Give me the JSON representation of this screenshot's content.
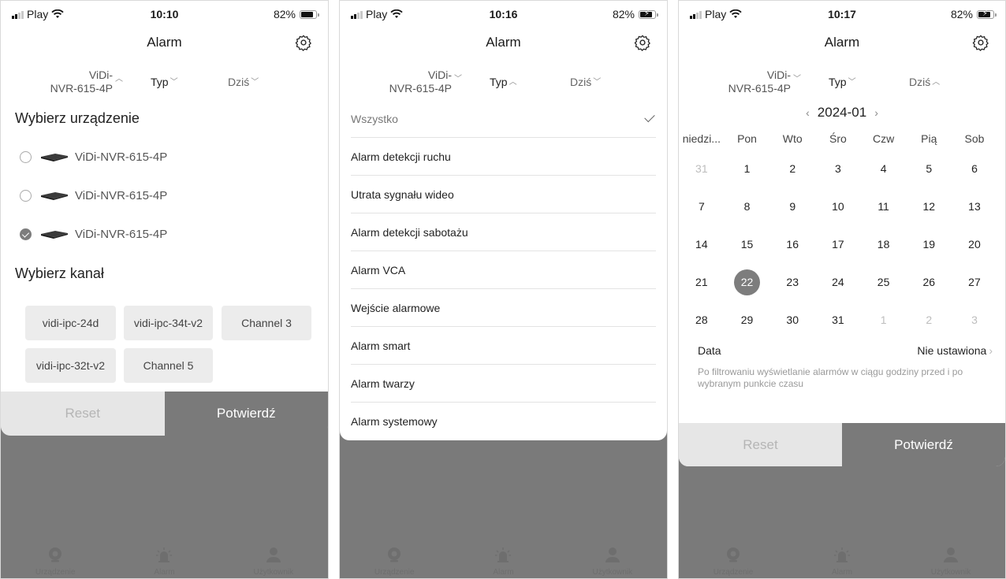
{
  "colors": {
    "accent": "#7a7a7a",
    "overlay": "#7a7a7a",
    "muted_text": "#bdbdbd"
  },
  "screens": [
    {
      "status": {
        "carrier": "Play",
        "time": "10:10",
        "battery": "82%",
        "charging": false
      },
      "title": "Alarm",
      "filters": {
        "device_line1": "ViDi-",
        "device_line2": "NVR-615-4P",
        "type": "Typ",
        "date": "Dziś"
      },
      "select_device_title": "Wybierz urządzenie",
      "devices": [
        {
          "name": "ViDi-NVR-615-4P",
          "selected": false
        },
        {
          "name": "ViDi-NVR-615-4P",
          "selected": false
        },
        {
          "name": "ViDi-NVR-615-4P",
          "selected": true
        }
      ],
      "select_channel_title": "Wybierz kanał",
      "channels": [
        "vidi-ipc-24d",
        "vidi-ipc-34t-v2",
        "Channel 3",
        "vidi-ipc-32t-v2",
        "Channel 5"
      ],
      "reset_label": "Reset",
      "confirm_label": "Potwierdź"
    },
    {
      "status": {
        "carrier": "Play",
        "time": "10:16",
        "battery": "82%",
        "charging": true
      },
      "title": "Alarm",
      "filters": {
        "device_line1": "ViDi-",
        "device_line2": "NVR-615-4P",
        "type": "Typ",
        "date": "Dziś"
      },
      "types": [
        "Wszystko",
        "Alarm detekcji ruchu",
        "Utrata sygnału wideo",
        "Alarm detekcji sabotażu",
        "Alarm VCA",
        "Wejście alarmowe",
        "Alarm smart",
        "Alarm twarzy",
        "Alarm systemowy"
      ],
      "selected_type": "Wszystko"
    },
    {
      "status": {
        "carrier": "Play",
        "time": "10:17",
        "battery": "82%",
        "charging": true
      },
      "title": "Alarm",
      "filters": {
        "device_line1": "ViDi-",
        "device_line2": "NVR-615-4P",
        "type": "Typ",
        "date": "Dziś"
      },
      "month": "2024-01",
      "weekdays": [
        "niedzi...",
        "Pon",
        "Wto",
        "Śro",
        "Czw",
        "Pią",
        "Sob"
      ],
      "weeks": [
        [
          "31",
          "1",
          "2",
          "3",
          "4",
          "5",
          "6"
        ],
        [
          "7",
          "8",
          "9",
          "10",
          "11",
          "12",
          "13"
        ],
        [
          "14",
          "15",
          "16",
          "17",
          "18",
          "19",
          "20"
        ],
        [
          "21",
          "22",
          "23",
          "24",
          "25",
          "26",
          "27"
        ],
        [
          "28",
          "29",
          "30",
          "31",
          "1",
          "2",
          "3"
        ]
      ],
      "selected_day": "22",
      "data_label": "Data",
      "data_value": "Nie ustawiona",
      "note": "Po filtrowaniu wyświetlanie alarmów w ciągu godziny przed i po wybranym punkcie czasu",
      "reset_label": "Reset",
      "confirm_label": "Potwierdź"
    }
  ],
  "tabs": [
    {
      "label": "Urządzenie",
      "icon": "camera-icon"
    },
    {
      "label": "Alarm",
      "icon": "siren-icon"
    },
    {
      "label": "Użytkownik",
      "icon": "user-icon"
    }
  ]
}
